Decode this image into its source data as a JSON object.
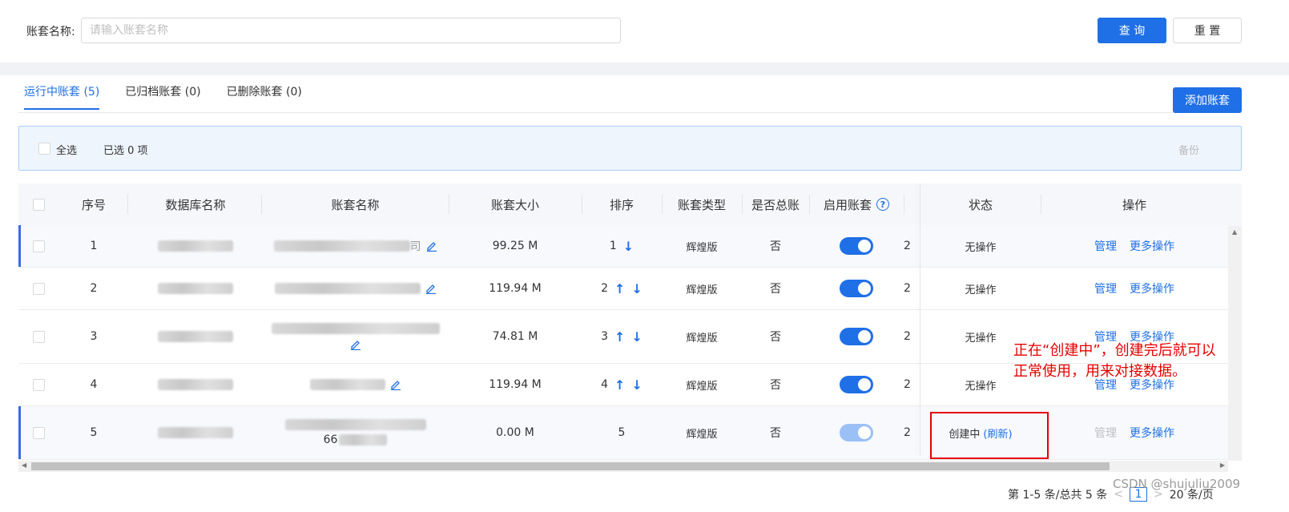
{
  "search": {
    "label": "账套名称:",
    "placeholder": "请输入账套名称",
    "query_label": "查 询",
    "reset_label": "重 置"
  },
  "tabs": [
    {
      "label": "运行中账套 (5)",
      "active": true
    },
    {
      "label": "已归档账套 (0)",
      "active": false
    },
    {
      "label": "已删除账套 (0)",
      "active": false
    }
  ],
  "add_button_label": "添加账套",
  "selection": {
    "select_all": "全选",
    "selected_count": "已选 0 项",
    "backup": "备份"
  },
  "table": {
    "columns": {
      "index": "序号",
      "db_name": "数据库名称",
      "name": "账套名称",
      "size": "账套大小",
      "order": "排序",
      "type": "账套类型",
      "is_master": "是否总账",
      "enabled": "启用账套",
      "status": "状态",
      "actions": "操作"
    },
    "rows": [
      {
        "index": "1",
        "size": "99.25 M",
        "order": "1",
        "type": "辉煌版",
        "is_master": "否",
        "status": "无操作",
        "name_suffix": "司",
        "enabled": true
      },
      {
        "index": "2",
        "size": "119.94 M",
        "order": "2",
        "type": "辉煌版",
        "is_master": "否",
        "status": "无操作",
        "name_suffix": "",
        "enabled": true
      },
      {
        "index": "3",
        "size": "74.81 M",
        "order": "3",
        "type": "辉煌版",
        "is_master": "否",
        "status": "无操作",
        "name_suffix": "",
        "enabled": true
      },
      {
        "index": "4",
        "size": "119.94 M",
        "order": "4",
        "type": "辉煌版",
        "is_master": "否",
        "status": "无操作",
        "name_suffix": "",
        "enabled": true
      },
      {
        "index": "5",
        "size": "0.00 M",
        "order": "5",
        "type": "辉煌版",
        "is_master": "否",
        "status": "创建中",
        "status_link": "(刷新)",
        "name_suffix": "66",
        "enabled": true
      }
    ],
    "action_manage": "管理",
    "action_more": "更多操作",
    "clipped_column_char": "2"
  },
  "pagination": {
    "summary": "第 1-5 条/总共 5 条",
    "current_page": "1",
    "page_size": "20 条/页"
  },
  "annotation": {
    "text": "正在“创建中”，创建完后就可以正常使用，用来对接数据。"
  },
  "watermark": "CSDN @shujuliu2009",
  "colors": {
    "primary": "#1f6fe6",
    "annotation": "#e60000"
  }
}
